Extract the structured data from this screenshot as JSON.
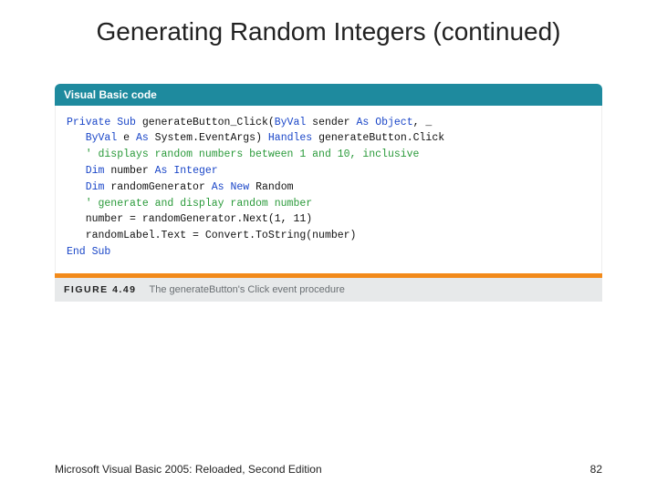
{
  "title": "Generating Random Integers (continued)",
  "figure": {
    "header": "Visual Basic code",
    "label": "FIGURE 4.49",
    "caption": "The generateButton's Click event procedure"
  },
  "code": {
    "l1a": "Private Sub",
    "l1b": " generateButton_Click(",
    "l1c": "ByVal",
    "l1d": " sender ",
    "l1e": "As Object",
    "l1f": ", _",
    "l2a": "   ",
    "l2b": "ByVal",
    "l2c": " e ",
    "l2d": "As",
    "l2e": " System.EventArgs) ",
    "l2f": "Handles",
    "l2g": " generateButton.Click",
    "l3": "   ' displays random numbers between 1 and 10, inclusive",
    "l4": "",
    "l5a": "   ",
    "l5b": "Dim",
    "l5c": " number ",
    "l5d": "As Integer",
    "l6a": "   ",
    "l6b": "Dim",
    "l6c": " randomGenerator ",
    "l6d": "As New",
    "l6e": " Random",
    "l7": "",
    "l8": "   ' generate and display random number",
    "l9": "   number = randomGenerator.Next(1, 11)",
    "l10": "   randomLabel.Text = Convert.ToString(number)",
    "l11": "End Sub"
  },
  "footer": {
    "source": "Microsoft Visual Basic 2005: Reloaded, Second Edition",
    "page": "82"
  }
}
